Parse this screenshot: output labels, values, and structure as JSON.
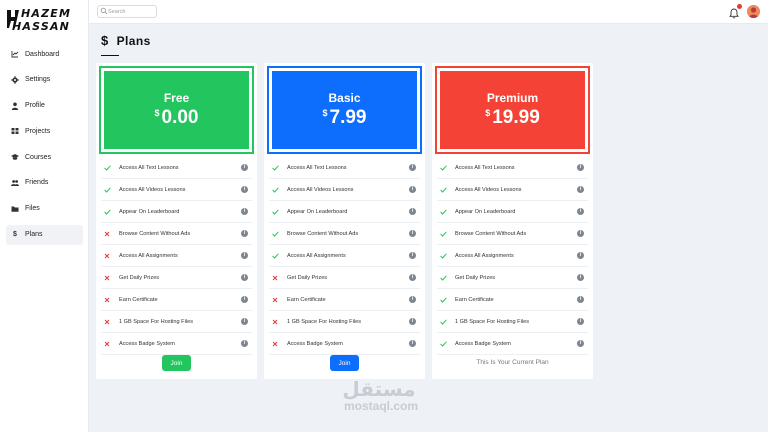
{
  "logo": {
    "line1": "HAZEM",
    "line2": "HASSAN"
  },
  "search": {
    "placeholder": "Search"
  },
  "sidebar": {
    "items": [
      {
        "label": "Dashboard",
        "icon": "chart-icon"
      },
      {
        "label": "Settings",
        "icon": "gear-icon"
      },
      {
        "label": "Profile",
        "icon": "user-icon"
      },
      {
        "label": "Projects",
        "icon": "projects-icon"
      },
      {
        "label": "Courses",
        "icon": "graduation-cap-icon"
      },
      {
        "label": "Friends",
        "icon": "users-icon"
      },
      {
        "label": "Files",
        "icon": "folder-icon"
      },
      {
        "label": "Plans",
        "icon": "dollar-icon",
        "active": true
      }
    ]
  },
  "page": {
    "title": "Plans",
    "title_icon": "$"
  },
  "colors": {
    "free": "#22c55e",
    "basic": "#0d6efd",
    "premium": "#f44336"
  },
  "plans": [
    {
      "name": "Free",
      "currency": "$",
      "price": "0.00",
      "action": "Join",
      "features": [
        {
          "text": "Access All Text Lessons",
          "included": true
        },
        {
          "text": "Access All Videos Lessons",
          "included": true
        },
        {
          "text": "Appear On Leaderboard",
          "included": true
        },
        {
          "text": "Browse Content Without Ads",
          "included": false
        },
        {
          "text": "Access All Assignments",
          "included": false
        },
        {
          "text": "Get Daily Prizes",
          "included": false
        },
        {
          "text": "Earn Certificate",
          "included": false
        },
        {
          "text": "1 GB Space For Hosting Files",
          "included": false
        },
        {
          "text": "Access Badge System",
          "included": false
        }
      ]
    },
    {
      "name": "Basic",
      "currency": "$",
      "price": "7.99",
      "action": "Join",
      "features": [
        {
          "text": "Access All Text Lessons",
          "included": true
        },
        {
          "text": "Access All Videos Lessons",
          "included": true
        },
        {
          "text": "Appear On Leaderboard",
          "included": true
        },
        {
          "text": "Browse Content Without Ads",
          "included": true
        },
        {
          "text": "Access All Assignments",
          "included": true
        },
        {
          "text": "Get Daily Prizes",
          "included": false
        },
        {
          "text": "Earn Certificate",
          "included": false
        },
        {
          "text": "1 GB Space For Hosting Files",
          "included": false
        },
        {
          "text": "Access Badge System",
          "included": false
        }
      ]
    },
    {
      "name": "Premium",
      "currency": "$",
      "price": "19.99",
      "status": "This Is Your Current Plan",
      "features": [
        {
          "text": "Access All Text Lessons",
          "included": true
        },
        {
          "text": "Access All Videos Lessons",
          "included": true
        },
        {
          "text": "Appear On Leaderboard",
          "included": true
        },
        {
          "text": "Browse Content Without Ads",
          "included": true
        },
        {
          "text": "Access All Assignments",
          "included": true
        },
        {
          "text": "Get Daily Prizes",
          "included": true
        },
        {
          "text": "Earn Certificate",
          "included": true
        },
        {
          "text": "1 GB Space For Hosting Files",
          "included": true
        },
        {
          "text": "Access Badge System",
          "included": true
        }
      ]
    }
  ],
  "watermark": {
    "arabic": "مستقل",
    "latin": "mostaql.com"
  }
}
